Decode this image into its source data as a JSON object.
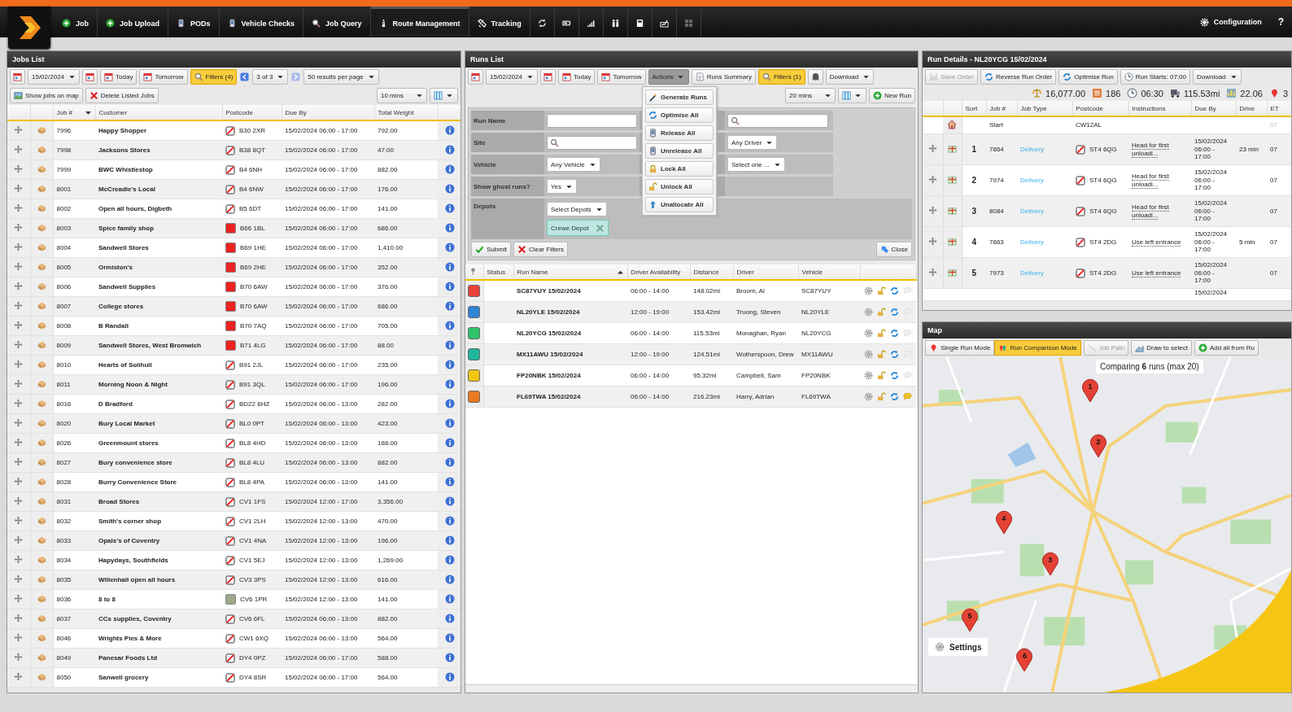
{
  "nav": {
    "items": [
      {
        "label": "Job",
        "selected": false
      },
      {
        "label": "Job Upload",
        "selected": false
      },
      {
        "label": "PODs",
        "selected": false
      },
      {
        "label": "Vehicle Checks",
        "selected": false
      },
      {
        "label": "Job Query",
        "selected": false
      },
      {
        "label": "Route Management",
        "selected": true
      },
      {
        "label": "Tracking",
        "selected": false
      }
    ],
    "configuration": "Configuration",
    "help": "?"
  },
  "jobs_list": {
    "title": "Jobs List",
    "date": "15/02/2024",
    "today": "Today",
    "tomorrow": "Tomorrow",
    "filters": "Filters (4)",
    "page": "3 of 3",
    "page_size": "50 results per page",
    "show_on_map": "Show jobs on map",
    "delete": "Delete Listed Jobs",
    "interval": "10 mins",
    "columns": [
      {
        "label": "Job #",
        "sorted": true,
        "descending": true
      },
      {
        "label": "Customer",
        "sorted": false
      },
      {
        "label": "Postcode",
        "sorted": false
      },
      {
        "label": "Due By",
        "sorted": false
      },
      {
        "label": "Total Weight",
        "sorted": false
      }
    ],
    "rows": [
      {
        "job": "7996",
        "customer": "Happy Shopper",
        "postcode": "B30 2XR",
        "due": "15/02/2024 06:00 - 17:00",
        "weight": "792.00"
      },
      {
        "job": "7998",
        "customer": "Jacksons Stores",
        "postcode": "B38 8QT",
        "due": "15/02/2024 06:00 - 17:00",
        "weight": "47.00"
      },
      {
        "job": "7999",
        "customer": "BWC Whistlestop",
        "postcode": "B4 6NH",
        "due": "15/02/2024 06:00 - 17:00",
        "weight": "882.00"
      },
      {
        "job": "8001",
        "customer": "McCreadie's Local",
        "postcode": "B4 6NW",
        "due": "15/02/2024 06:00 - 17:00",
        "weight": "176.00"
      },
      {
        "job": "8002",
        "customer": "Open all hours, Digbeth",
        "postcode": "B5 6DT",
        "due": "15/02/2024 06:00 - 17:00",
        "weight": "141.00"
      },
      {
        "job": "8003",
        "customer": "Spice family shop",
        "postcode": "B66 1BL",
        "due": "15/02/2024 06:00 - 17:00",
        "weight": "686.00",
        "color": "#ee2222"
      },
      {
        "job": "8004",
        "customer": "Sandwell Stores",
        "postcode": "B69 1HE",
        "due": "15/02/2024 06:00 - 17:00",
        "weight": "1,410.00",
        "color": "#ee2222"
      },
      {
        "job": "8005",
        "customer": "Ormiston's",
        "postcode": "B69 2HE",
        "due": "15/02/2024 06:00 - 17:00",
        "weight": "352.00",
        "color": "#ee2222"
      },
      {
        "job": "8006",
        "customer": "Sandwell Supplies",
        "postcode": "B70 6AW",
        "due": "15/02/2024 06:00 - 17:00",
        "weight": "376.00",
        "color": "#ee2222"
      },
      {
        "job": "8007",
        "customer": "College stores",
        "postcode": "B70 6AW",
        "due": "15/02/2024 06:00 - 17:00",
        "weight": "686.00",
        "color": "#ee2222"
      },
      {
        "job": "8008",
        "customer": "B Randall",
        "postcode": "B70 7AQ",
        "due": "15/02/2024 06:00 - 17:00",
        "weight": "705.00",
        "color": "#ee2222"
      },
      {
        "job": "8009",
        "customer": "Sandwell Stores, West Bromwich",
        "postcode": "B71 4LG",
        "due": "15/02/2024 06:00 - 17:00",
        "weight": "88.00",
        "color": "#ee2222"
      },
      {
        "job": "8010",
        "customer": "Hearts of Solihull",
        "postcode": "B91 2JL",
        "due": "15/02/2024 06:00 - 17:00",
        "weight": "235.00"
      },
      {
        "job": "8011",
        "customer": "Morning Noon & Night",
        "postcode": "B91 3QL",
        "due": "15/02/2024 06:00 - 17:00",
        "weight": "196.00"
      },
      {
        "job": "8016",
        "customer": "D Bradford",
        "postcode": "BD22 6HZ",
        "due": "15/02/2024 06:00 - 13:00",
        "weight": "282.00"
      },
      {
        "job": "8020",
        "customer": "Bury Local Market",
        "postcode": "BL0 0PT",
        "due": "15/02/2024 06:00 - 13:00",
        "weight": "423.00"
      },
      {
        "job": "8026",
        "customer": "Greenmount stores",
        "postcode": "BL8 4HD",
        "due": "15/02/2024 06:00 - 13:00",
        "weight": "188.00"
      },
      {
        "job": "8027",
        "customer": "Bury convenience store",
        "postcode": "BL8 4LU",
        "due": "15/02/2024 06:00 - 13:00",
        "weight": "882.00"
      },
      {
        "job": "8028",
        "customer": "Burry Convenience Store",
        "postcode": "BL8 4PA",
        "due": "15/02/2024 06:00 - 13:00",
        "weight": "141.00"
      },
      {
        "job": "8031",
        "customer": "Broad Stores",
        "postcode": "CV1 1FS",
        "due": "15/02/2024 12:00 - 17:00",
        "weight": "3,356.00"
      },
      {
        "job": "8032",
        "customer": "Smith's corner shop",
        "postcode": "CV1 2LH",
        "due": "15/02/2024 12:00 - 13:00",
        "weight": "470.00"
      },
      {
        "job": "8033",
        "customer": "Opals's of Coventry",
        "postcode": "CV1 4NA",
        "due": "15/02/2024 12:00 - 13:00",
        "weight": "196.00"
      },
      {
        "job": "8034",
        "customer": "Hapydays, Southfields",
        "postcode": "CV1 5EJ",
        "due": "15/02/2024 12:00 - 13:00",
        "weight": "1,269.00"
      },
      {
        "job": "8035",
        "customer": "Willenhall open all hours",
        "postcode": "CV3 3PS",
        "due": "15/02/2024 12:00 - 13:00",
        "weight": "616.00"
      },
      {
        "job": "8036",
        "customer": "8 to 8",
        "postcode": "CV6 1PR",
        "due": "15/02/2024 12:00 - 13:00",
        "weight": "141.00",
        "color": "#9ca88a"
      },
      {
        "job": "8037",
        "customer": "CCs supplies, Coventry",
        "postcode": "CV6 6FL",
        "due": "15/02/2024 06:00 - 13:00",
        "weight": "882.00"
      },
      {
        "job": "8046",
        "customer": "Wrights Pies & More",
        "postcode": "CW1 6XQ",
        "due": "15/02/2024 06:00 - 13:00",
        "weight": "564.00"
      },
      {
        "job": "8049",
        "customer": "Panesar Foods Ltd",
        "postcode": "DY4 0PZ",
        "due": "15/02/2024 06:00 - 17:00",
        "weight": "588.00"
      },
      {
        "job": "8050",
        "customer": "Sanwell grocery",
        "postcode": "DY4 8SR",
        "due": "15/02/2024 06:00 - 17:00",
        "weight": "564.00"
      }
    ]
  },
  "runs_list": {
    "title": "Runs List",
    "date": "15/02/2024",
    "today": "Today",
    "tomorrow": "Tomorrow",
    "actions": "Actions",
    "summary": "Runs Summary",
    "filters": "Filters (1)",
    "download": "Download",
    "interval": "20 mins",
    "new_run": "New Run",
    "filter_form": {
      "fields": [
        {
          "label": "Run Name",
          "kind": "text"
        },
        {
          "label": "Site",
          "kind": "search"
        },
        {
          "label": "Vehicle",
          "kind": "select",
          "value": "Any Vehicle"
        },
        {
          "label": "Show ghost runs?",
          "kind": "select",
          "value": "Yes"
        }
      ],
      "right_fields": [
        {
          "kind": "search"
        },
        {
          "kind": "select",
          "value": "Any Driver"
        },
        {
          "kind": "select",
          "value": "Select one ..."
        }
      ],
      "depots": {
        "label": "Depots",
        "select": "Select Depots",
        "chips": [
          "Crewe Depot"
        ]
      },
      "submit": "Submit",
      "clear": "Clear Filters",
      "close": "Close"
    },
    "actions_menu": [
      "Generate Runs",
      "Optimise All",
      "Release All",
      "Unrelease All",
      "Lock All",
      "Unlock All",
      "Unallocate All"
    ],
    "columns": [
      {
        "label": "Status",
        "sorted": false
      },
      {
        "label": "Run Name",
        "sorted": true,
        "descending": false
      },
      {
        "label": "Driver Availability",
        "sorted": false
      },
      {
        "label": "Distance",
        "sorted": false
      },
      {
        "label": "Driver",
        "sorted": false
      },
      {
        "label": "Vehicle",
        "sorted": false
      }
    ],
    "rows": [
      {
        "color": "#e8433a",
        "name": "SC87YUY 15/02/2024",
        "availability": "06:00 - 14:00",
        "distance": "148.02mi",
        "driver": "Broom, Al",
        "vehicle": "SC87YUY",
        "has_message": false
      },
      {
        "color": "#2f86d6",
        "name": "NL20YLE 15/02/2024",
        "availability": "12:00 - 19:00",
        "distance": "153.42mi",
        "driver": "Truong, Steven",
        "vehicle": "NL20YLE",
        "has_message": false
      },
      {
        "color": "#2ec46a",
        "name": "NL20YCG 15/02/2024",
        "availability": "06:00 - 14:00",
        "distance": "115.53mi",
        "driver": "Monaghan, Ryan",
        "vehicle": "NL20YCG",
        "has_message": false
      },
      {
        "color": "#1fb59a",
        "name": "MX11AWU 15/02/2024",
        "availability": "12:00 - 19:00",
        "distance": "124.51mi",
        "driver": "Wotherspoon, Drew",
        "vehicle": "MX11AWU",
        "has_message": false
      },
      {
        "color": "#f2c511",
        "name": "FP20NBK 15/02/2024",
        "availability": "06:00 - 14:00",
        "distance": "95.32mi",
        "driver": "Campbell, Sam",
        "vehicle": "FP20NBK",
        "has_message": false
      },
      {
        "color": "#ea7a22",
        "name": "FL69TWA 15/02/2024",
        "availability": "06:00 - 14:00",
        "distance": "216.23mi",
        "driver": "Harry, Adrian",
        "vehicle": "FL69TWA",
        "has_message": true
      }
    ]
  },
  "run_details": {
    "title": "Run Details - NL20YCG 15/02/2024",
    "buttons": [
      {
        "label": "Save Order",
        "disabled": true
      },
      {
        "label": "Reverse Run Order",
        "disabled": false
      },
      {
        "label": "Optimise Run",
        "disabled": false
      },
      {
        "label": "Run Starts: 07:00",
        "disabled": false
      }
    ],
    "download": "Download",
    "stats": [
      "16,077.00",
      "186",
      "06:30",
      "115.53mi",
      "22.06",
      "3"
    ],
    "columns": [
      "Sort",
      "Job #",
      "Job Type",
      "Postcode",
      "Instructions",
      "Due By",
      "Drive",
      "ET"
    ],
    "start": {
      "label": "Start",
      "postcode": "CW12AL",
      "eta": "07"
    },
    "rows": [
      {
        "sort": "1",
        "job": "7864",
        "type": "Delivery",
        "postcode": "ST4 6QG",
        "instructions": "Head for first unloadi...",
        "due": "15/02/2024 06:00 - 17:00",
        "drive": "23 min",
        "eta": "07"
      },
      {
        "sort": "2",
        "job": "7974",
        "type": "Delivery",
        "postcode": "ST4 6QG",
        "instructions": "Head for first unloadi...",
        "due": "15/02/2024 06:00 - 17:00",
        "drive": "",
        "eta": "07"
      },
      {
        "sort": "3",
        "job": "8084",
        "type": "Delivery",
        "postcode": "ST4 6QG",
        "instructions": "Head for first unloadi...",
        "due": "15/02/2024 06:00 - 17:00",
        "drive": "",
        "eta": "07"
      },
      {
        "sort": "4",
        "job": "7863",
        "type": "Delivery",
        "postcode": "ST4 2DG",
        "instructions": "Use left entrance",
        "due": "15/02/2024 06:00 - 17:00",
        "drive": "5 min",
        "eta": "07"
      },
      {
        "sort": "5",
        "job": "7973",
        "type": "Delivery",
        "postcode": "ST4 2DG",
        "instructions": "Use left entrance",
        "due": "15/02/2024 06:00 - 17:00",
        "drive": "",
        "eta": "07"
      }
    ],
    "partial_row_due": "15/02/2024"
  },
  "map": {
    "title": "Map",
    "modes": [
      {
        "label": "Single Run Mode",
        "selected": false
      },
      {
        "label": "Run Comparison Mode",
        "selected": true
      }
    ],
    "job_path": {
      "label": "Job Path",
      "disabled": true
    },
    "draw": "Draw to select",
    "add_all": "Add all from Ru",
    "comparing": "Comparing **6** runs (max 20)",
    "pins": [
      "1",
      "2",
      "3",
      "4",
      "5",
      "6"
    ],
    "settings": "Settings"
  }
}
